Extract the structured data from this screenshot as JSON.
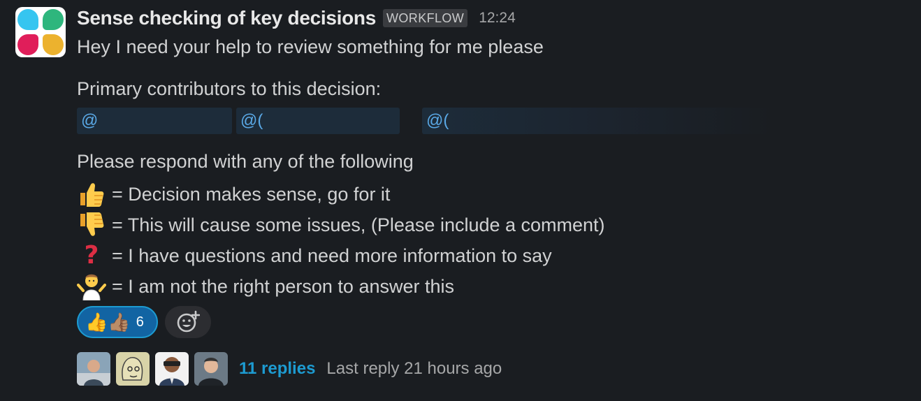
{
  "message": {
    "sender": "Sense checking of key decisions",
    "badge": "WORKFLOW",
    "timestamp": "12:24",
    "intro": "Hey I need your help to review something for me please",
    "contributors_label": "Primary contributors to this decision:",
    "mentions": [
      "@",
      "@(",
      "@("
    ],
    "respond_label": "Please respond with any of the following",
    "legend": [
      {
        "icon": "thumbs-up",
        "text": "= Decision makes sense, go for it"
      },
      {
        "icon": "thumbs-down",
        "text": "= This will cause some issues, (Please include a comment)"
      },
      {
        "icon": "red-question-mark",
        "text": "= I have questions and need more information to say"
      },
      {
        "icon": "person-shrugging",
        "text": "= I am not the right person to answer this"
      }
    ]
  },
  "reactions": {
    "count": "6",
    "emoji": "👍👍🏽"
  },
  "thread": {
    "replies": "11 replies",
    "last_reply": "Last reply 21 hours ago"
  },
  "colors": {
    "background": "#1a1d21",
    "link": "#1d9bd1",
    "reaction_active": "#1264a3",
    "mention_bg": "#1d2c3a"
  }
}
